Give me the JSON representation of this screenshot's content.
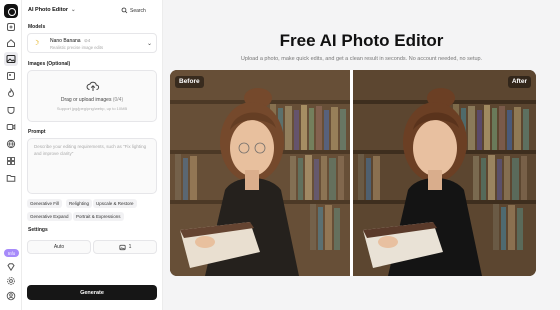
{
  "sidebar": {
    "badge": "Info"
  },
  "panel": {
    "title": "AI Photo Editor",
    "search_label": "Search",
    "models_label": "Models",
    "model": {
      "name": "Nano Banana",
      "tag": "⊘4",
      "desc": "Realistic precise image edits"
    },
    "images_label": "Images (Optional)",
    "upload_title": "Drag or upload images",
    "upload_count": "(0/4)",
    "upload_sub": "Support jpg/jpeg/png/webp, up to 10MB",
    "prompt_label": "Prompt",
    "prompt_placeholder": "Describe your editing requirements, such as \"Fix lighting and improve clarity\"",
    "tags": [
      "Generative Fill",
      "Relighting",
      "Upscale & Restore",
      "Generative Expand",
      "Portrait & Expressions"
    ],
    "settings_label": "Settings",
    "aspect": "Auto",
    "count": "1",
    "generate": "Generate"
  },
  "main": {
    "title": "Free AI Photo Editor",
    "subtitle": "Upload a photo, make quick edits, and get a clean result in seconds. No account needed, no setup.",
    "before": "Before",
    "after": "After"
  },
  "colors": {
    "accent": "#161616",
    "badge": "#a78bfa"
  }
}
